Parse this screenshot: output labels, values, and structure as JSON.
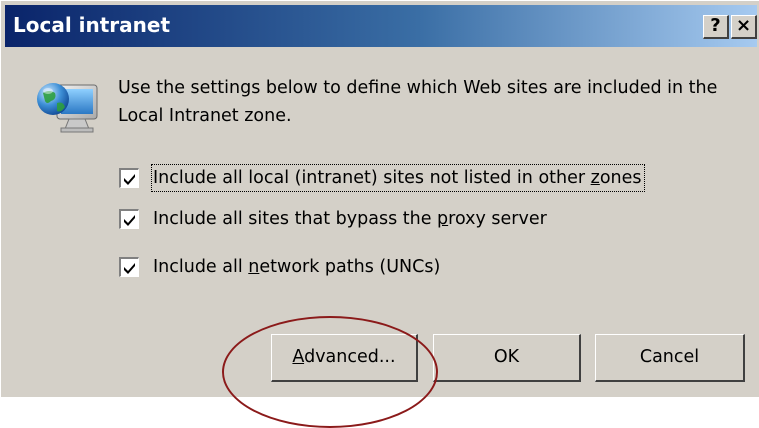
{
  "window": {
    "title": "Local intranet",
    "help_label": "?",
    "close_label": "×"
  },
  "description": "Use the settings below to define which Web sites are included in the Local Intranet zone.",
  "checkboxes": [
    {
      "label_pre": "Include all local (intranet) sites not listed in other ",
      "label_key": "z",
      "label_post": "ones",
      "checked": true,
      "focused": true
    },
    {
      "label_pre": "Include all sites that bypass the ",
      "label_key": "p",
      "label_post": "roxy server",
      "checked": true,
      "focused": false
    },
    {
      "label_pre": "Include all ",
      "label_key": "n",
      "label_post": "etwork paths (UNCs)",
      "checked": true,
      "focused": false
    }
  ],
  "buttons": {
    "advanced_key": "A",
    "advanced_rest": "dvanced...",
    "ok": "OK",
    "cancel": "Cancel"
  },
  "annotation": {
    "color": "#8b1a1a"
  },
  "icon": "network-globe-computer-icon"
}
